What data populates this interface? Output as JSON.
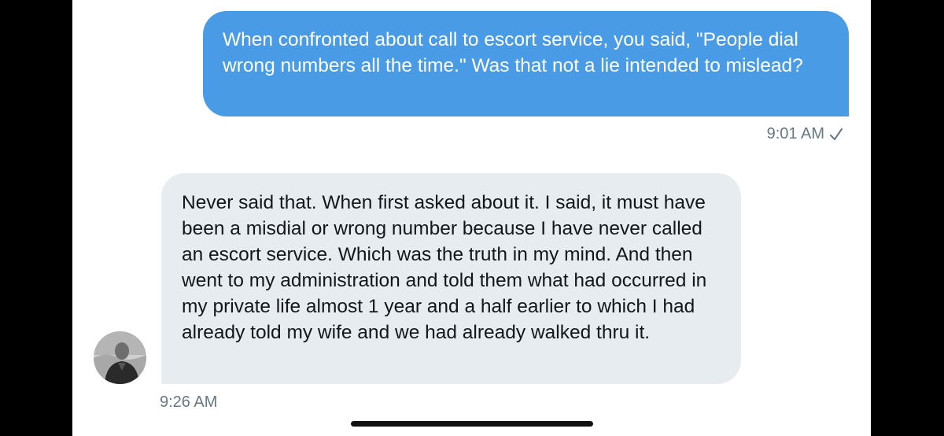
{
  "conversation": {
    "sent_message": {
      "text": "When confronted about call to escort service, you said, \"People dial wrong numbers all the time.\" Was that not a lie intended to mislead?",
      "time": "9:01 AM",
      "status_icon": "check-icon"
    },
    "received_message": {
      "text": "Never said that. When first asked about it. I said, it must have been a misdial or wrong number because I have never called an escort service. Which was the truth in my mind. And then went to my administration and told them what had occurred in my private life almost 1 year and a half earlier to which I had already told my wife and we had already walked thru it.",
      "time": "9:26 AM"
    }
  },
  "colors": {
    "sent_bubble": "#4a9be6",
    "received_bubble": "#e6ecf0",
    "timestamp": "#657786"
  }
}
